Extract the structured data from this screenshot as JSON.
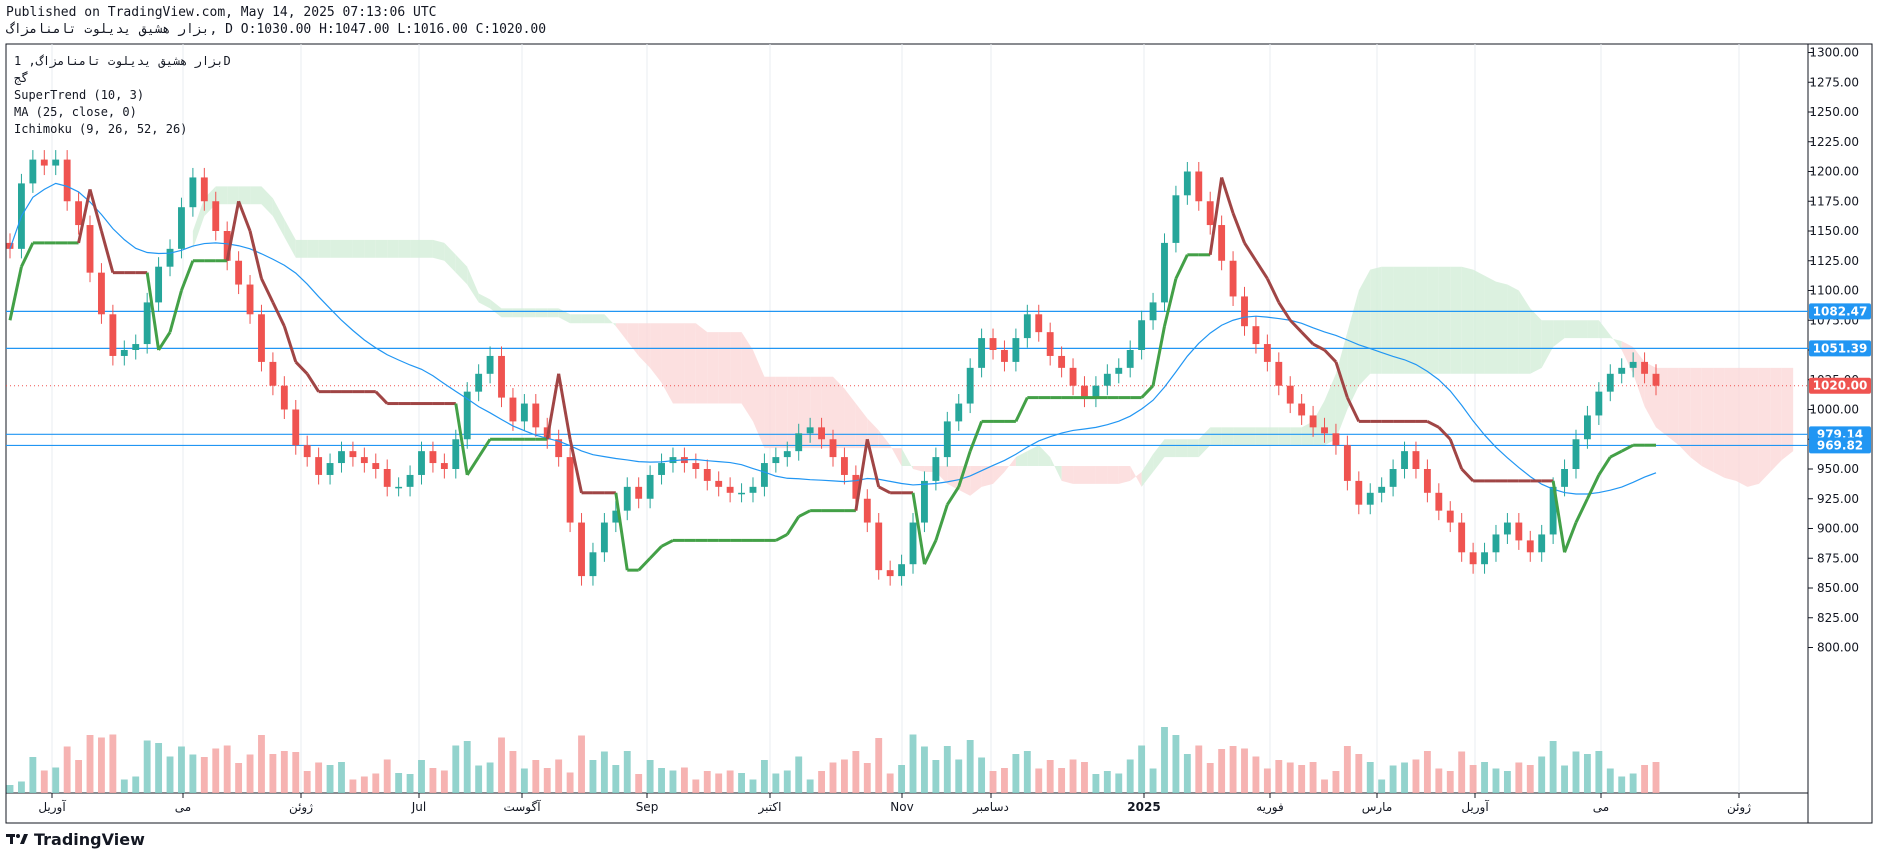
{
  "header": {
    "published": "Published on TradingView.com, May 14, 2025 07:13:06 UTC",
    "symbol_line": "بزار هشيق يديلوت تامنامزاگ, D O:1030.00 H:1047.00 L:1016.00 C:1020.00"
  },
  "legend": {
    "symbol": "بزار هشيق يديلوت تامنامزاگ, 1D",
    "exchange": "گج",
    "supertrend": "SuperTrend (10, 3)",
    "ma": "MA (25, close, 0)",
    "ichimoku": "Ichimoku (9, 26, 52, 26)"
  },
  "brand": {
    "name": "TradingView"
  },
  "colors": {
    "up": "#26a69a",
    "down": "#ef5350",
    "supertrend_up": "#43a047",
    "supertrend_down": "#a04545",
    "ma": "#2196f3",
    "cloud_bear": "#fbdada",
    "cloud_bull": "#d6efdb",
    "level": "#2196f3",
    "last_price": "#ef5350"
  },
  "chart_data": {
    "type": "candlestick",
    "y_ticks": [
      "1300.00",
      "1275.00",
      "1250.00",
      "1225.00",
      "1200.00",
      "1175.00",
      "1150.00",
      "1125.00",
      "1100.00",
      "1075.00",
      "1050.00",
      "1025.00",
      "1000.00",
      "975.00",
      "950.00",
      "925.00",
      "900.00",
      "875.00",
      "850.00",
      "825.00",
      "800.00"
    ],
    "ylim": [
      780,
      1305
    ],
    "x_labels": [
      "آوريل",
      "مى",
      "ژوئن",
      "Jul",
      "آگوست",
      "Sep",
      "اكتبر",
      "Nov",
      "دسامبر",
      "2025",
      "فوريه",
      "مارس",
      "آوريل",
      "مى",
      "ژوئن"
    ],
    "price_labels": [
      {
        "text": "1082.47",
        "value": 1082.47,
        "color": "#2196f3"
      },
      {
        "text": "1051.39",
        "value": 1051.39,
        "color": "#2196f3"
      },
      {
        "text": "1020.00",
        "value": 1020.0,
        "color": "#ef5350"
      },
      {
        "text": "979.14",
        "value": 979.14,
        "color": "#2196f3"
      },
      {
        "text": "969.82",
        "value": 969.82,
        "color": "#2196f3"
      }
    ],
    "horizontal_levels": [
      1082.47,
      1051.39,
      979.14,
      969.82
    ],
    "last_price": 1020.0,
    "closes": [
      1135,
      1190,
      1210,
      1205,
      1210,
      1175,
      1155,
      1115,
      1080,
      1045,
      1050,
      1055,
      1090,
      1120,
      1135,
      1170,
      1195,
      1175,
      1150,
      1125,
      1105,
      1080,
      1040,
      1020,
      1000,
      970,
      960,
      945,
      955,
      965,
      960,
      955,
      950,
      935,
      935,
      945,
      965,
      955,
      950,
      975,
      1015,
      1030,
      1045,
      1010,
      990,
      1005,
      985,
      975,
      960,
      905,
      860,
      880,
      905,
      915,
      935,
      925,
      945,
      955,
      960,
      955,
      950,
      940,
      935,
      930,
      930,
      935,
      955,
      960,
      965,
      980,
      985,
      975,
      960,
      945,
      925,
      905,
      865,
      860,
      870,
      905,
      940,
      960,
      990,
      1005,
      1035,
      1060,
      1050,
      1040,
      1060,
      1080,
      1065,
      1045,
      1035,
      1020,
      1010,
      1020,
      1030,
      1035,
      1050,
      1075,
      1090,
      1140,
      1180,
      1200,
      1175,
      1155,
      1125,
      1095,
      1070,
      1055,
      1040,
      1020,
      1005,
      995,
      985,
      980,
      970,
      940,
      920,
      930,
      935,
      950,
      965,
      950,
      930,
      915,
      905,
      880,
      870,
      880,
      895,
      905,
      890,
      880,
      895,
      935,
      950,
      975,
      995,
      1015,
      1030,
      1035,
      1040,
      1030,
      1020
    ]
  }
}
